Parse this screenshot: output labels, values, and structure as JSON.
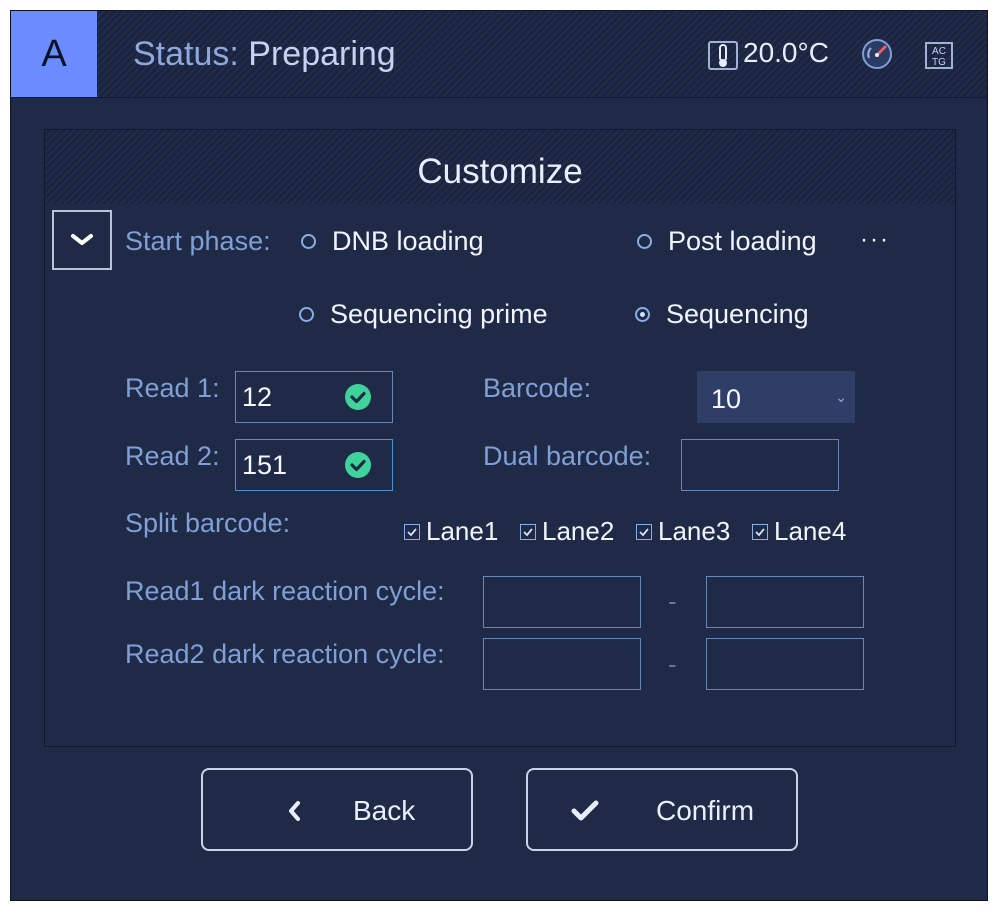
{
  "header": {
    "badge": "A",
    "status_label": "Status:",
    "status_value": "Preparing",
    "temperature": "20.0°C",
    "icons": [
      "thermometer-icon",
      "gauge-icon",
      "sequence-actg-icon"
    ],
    "actg_text_top": "AC",
    "actg_text_bottom": "TG"
  },
  "panel": {
    "title": "Customize",
    "start_phase_label": "Start phase:",
    "phases": [
      {
        "label": "DNB loading",
        "selected": false
      },
      {
        "label": "Post loading",
        "selected": false
      },
      {
        "label": "Sequencing prime",
        "selected": false
      },
      {
        "label": "Sequencing",
        "selected": true
      }
    ],
    "more": "···",
    "read1_label": "Read 1:",
    "read1_value": "12",
    "read2_label": "Read 2:",
    "read2_value": "151",
    "barcode_label": "Barcode:",
    "barcode_value": "10",
    "dual_barcode_label": "Dual barcode:",
    "dual_barcode_value": "",
    "split_barcode_label": "Split barcode:",
    "lanes": [
      {
        "label": "Lane1",
        "checked": true
      },
      {
        "label": "Lane2",
        "checked": true
      },
      {
        "label": "Lane3",
        "checked": true
      },
      {
        "label": "Lane4",
        "checked": true
      }
    ],
    "read1_dark_label": "Read1 dark reaction cycle:",
    "read2_dark_label": "Read2 dark reaction cycle:",
    "range_separator": "-"
  },
  "buttons": {
    "back_label": "Back",
    "confirm_label": "Confirm"
  },
  "colors": {
    "background": "#1f2a47",
    "header": "#1a2440",
    "accent_badge": "#6b8cff",
    "label": "#7f9fd6",
    "check_ok": "#3fd29a"
  }
}
